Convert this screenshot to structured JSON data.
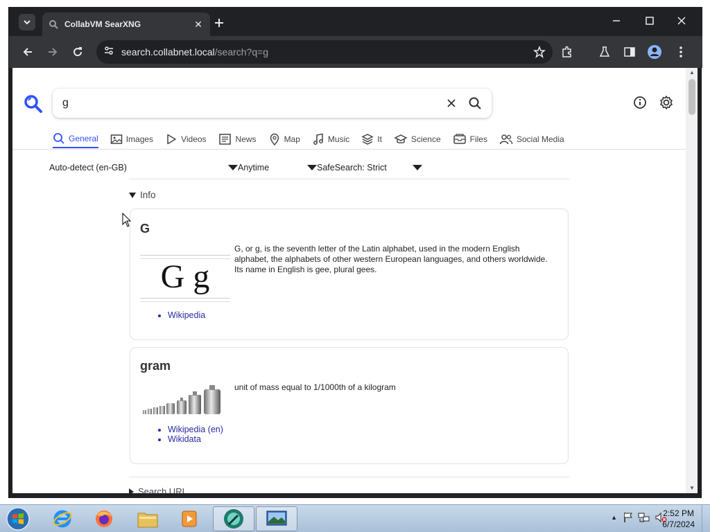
{
  "browser": {
    "tab_title": "CollabVM SearXNG",
    "url_host": "search.collabnet.local",
    "url_path": "/search?q=g"
  },
  "search": {
    "query": "g"
  },
  "categories": [
    {
      "label": "General",
      "icon": "search-icon",
      "active": true
    },
    {
      "label": "Images",
      "icon": "image-icon",
      "active": false
    },
    {
      "label": "Videos",
      "icon": "play-icon",
      "active": false
    },
    {
      "label": "News",
      "icon": "newspaper-icon",
      "active": false
    },
    {
      "label": "Map",
      "icon": "map-pin-icon",
      "active": false
    },
    {
      "label": "Music",
      "icon": "music-note-icon",
      "active": false
    },
    {
      "label": "It",
      "icon": "layers-icon",
      "active": false
    },
    {
      "label": "Science",
      "icon": "graduation-cap-icon",
      "active": false
    },
    {
      "label": "Files",
      "icon": "file-tray-icon",
      "active": false
    },
    {
      "label": "Social Media",
      "icon": "people-icon",
      "active": false
    }
  ],
  "filters": {
    "language": "Auto-detect (en-GB)",
    "time": "Anytime",
    "safesearch": "SafeSearch: Strict"
  },
  "info": {
    "summary": "Info",
    "cards": [
      {
        "title": "G",
        "image_text": "G g",
        "description": "G, or g, is the seventh letter of the Latin alphabet, used in the modern English alphabet, the alphabets of other western European languages, and others worldwide. Its name in English is gee, plural gees.",
        "links": [
          "Wikipedia"
        ]
      },
      {
        "title": "gram",
        "description": "unit of mass equal to 1/1000th of a kilogram",
        "links": [
          "Wikipedia (en)",
          "Wikidata"
        ]
      }
    ]
  },
  "search_url_summary": "Search URL",
  "taskbar": {
    "time": "2:52 PM",
    "date": "6/7/2024"
  },
  "colors": {
    "accent": "#3050ff",
    "link": "#2a2aa0",
    "browser_dark": "#202124"
  }
}
